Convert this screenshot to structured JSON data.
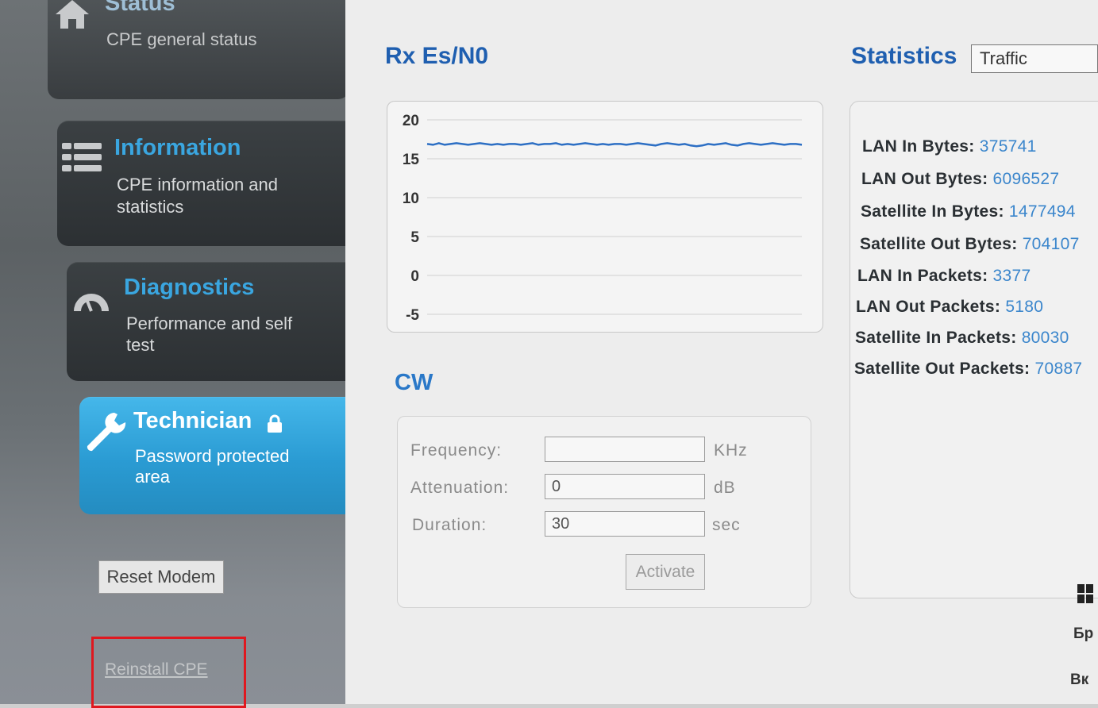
{
  "sidebar": {
    "status": {
      "title": "Status",
      "desc": "CPE general status"
    },
    "information": {
      "title": "Information",
      "desc_line1": "CPE information and",
      "desc_line2": "statistics"
    },
    "diagnostics": {
      "title": "Diagnostics",
      "desc_line1": "Performance and self",
      "desc_line2": "test"
    },
    "technician": {
      "title": "Technician",
      "desc_line1": "Password protected",
      "desc_line2": "area"
    },
    "reset_label": "Reset Modem",
    "reinstall_label": "Reinstall CPE"
  },
  "rx": {
    "title": "Rx Es/N0",
    "chart_data": {
      "type": "line",
      "title": "",
      "xlabel": "",
      "ylabel": "",
      "ylim": [
        -5,
        20
      ],
      "y_ticks": [
        "20",
        "15",
        "10",
        "5",
        "0",
        "-5"
      ],
      "grid": true,
      "series": [
        {
          "values": [
            16.9,
            16.8,
            17.0,
            16.8,
            16.9,
            17.0,
            16.9,
            16.8,
            16.9,
            17.0,
            16.9,
            16.8,
            16.9,
            16.8,
            16.9,
            16.9,
            16.8,
            16.9,
            17.0,
            16.8,
            16.9,
            16.9,
            17.0,
            16.8,
            16.9,
            16.8,
            16.9,
            17.0,
            16.9,
            16.8,
            16.9,
            16.8,
            16.9,
            16.9,
            16.8,
            16.9,
            17.0,
            16.9,
            16.8,
            16.7,
            16.9,
            17.0,
            16.9,
            16.8,
            16.9,
            16.7,
            16.6,
            16.7,
            16.9,
            16.8,
            16.9,
            17.0,
            16.8,
            16.7,
            16.9,
            17.0,
            16.9,
            16.8,
            16.9,
            17.0,
            16.9,
            16.8,
            16.9,
            16.9,
            16.8
          ]
        }
      ]
    }
  },
  "cw": {
    "title": "CW",
    "frequency_label": "Frequency:",
    "frequency_value": "",
    "frequency_unit": "KHz",
    "attenuation_label": "Attenuation:",
    "attenuation_value": "0",
    "attenuation_unit": "dB",
    "duration_label": "Duration:",
    "duration_value": "30",
    "duration_unit": "sec",
    "activate_label": "Activate"
  },
  "statistics": {
    "title": "Statistics",
    "selected": "Traffic",
    "rows": [
      {
        "label": "LAN In Bytes:",
        "value": "375741"
      },
      {
        "label": "LAN Out Bytes:",
        "value": "6096527"
      },
      {
        "label": "Satellite In Bytes:",
        "value": "1477494"
      },
      {
        "label": "Satellite Out Bytes:",
        "value": "704107"
      },
      {
        "label": "LAN In Packets:",
        "value": "3377"
      },
      {
        "label": "LAN Out Packets:",
        "value": "5180"
      },
      {
        "label": "Satellite In Packets:",
        "value": "80030"
      },
      {
        "label": "Satellite Out Packets:",
        "value": "70887"
      }
    ]
  },
  "edge": {
    "line1": "Бр",
    "line2": "Вк"
  },
  "colors": {
    "accent": "#3aa6e0",
    "heading": "#1f5fb0",
    "value": "#3b86cc",
    "highlight": "#e0181f",
    "line": "#2d6fc4"
  }
}
